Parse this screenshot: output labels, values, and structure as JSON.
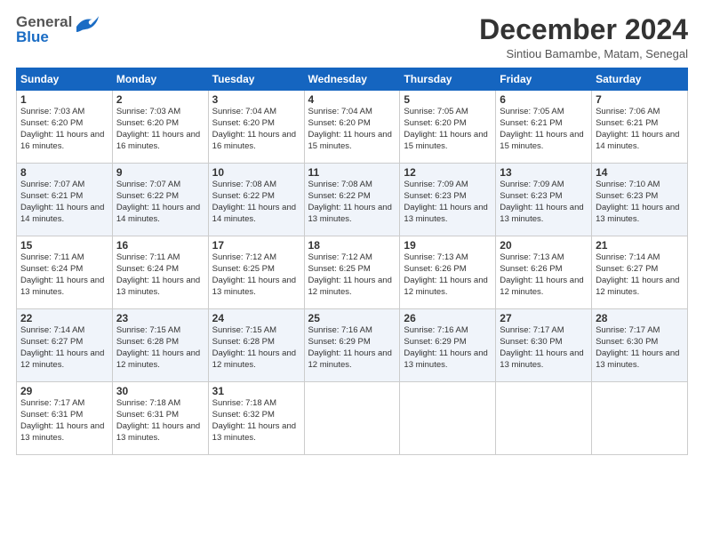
{
  "header": {
    "logo_line1": "General",
    "logo_line2": "Blue",
    "month_title": "December 2024",
    "location": "Sintiou Bamambe, Matam, Senegal"
  },
  "days_of_week": [
    "Sunday",
    "Monday",
    "Tuesday",
    "Wednesday",
    "Thursday",
    "Friday",
    "Saturday"
  ],
  "weeks": [
    [
      {
        "day": "1",
        "info": "Sunrise: 7:03 AM\nSunset: 6:20 PM\nDaylight: 11 hours and 16 minutes."
      },
      {
        "day": "2",
        "info": "Sunrise: 7:03 AM\nSunset: 6:20 PM\nDaylight: 11 hours and 16 minutes."
      },
      {
        "day": "3",
        "info": "Sunrise: 7:04 AM\nSunset: 6:20 PM\nDaylight: 11 hours and 16 minutes."
      },
      {
        "day": "4",
        "info": "Sunrise: 7:04 AM\nSunset: 6:20 PM\nDaylight: 11 hours and 15 minutes."
      },
      {
        "day": "5",
        "info": "Sunrise: 7:05 AM\nSunset: 6:20 PM\nDaylight: 11 hours and 15 minutes."
      },
      {
        "day": "6",
        "info": "Sunrise: 7:05 AM\nSunset: 6:21 PM\nDaylight: 11 hours and 15 minutes."
      },
      {
        "day": "7",
        "info": "Sunrise: 7:06 AM\nSunset: 6:21 PM\nDaylight: 11 hours and 14 minutes."
      }
    ],
    [
      {
        "day": "8",
        "info": "Sunrise: 7:07 AM\nSunset: 6:21 PM\nDaylight: 11 hours and 14 minutes."
      },
      {
        "day": "9",
        "info": "Sunrise: 7:07 AM\nSunset: 6:22 PM\nDaylight: 11 hours and 14 minutes."
      },
      {
        "day": "10",
        "info": "Sunrise: 7:08 AM\nSunset: 6:22 PM\nDaylight: 11 hours and 14 minutes."
      },
      {
        "day": "11",
        "info": "Sunrise: 7:08 AM\nSunset: 6:22 PM\nDaylight: 11 hours and 13 minutes."
      },
      {
        "day": "12",
        "info": "Sunrise: 7:09 AM\nSunset: 6:23 PM\nDaylight: 11 hours and 13 minutes."
      },
      {
        "day": "13",
        "info": "Sunrise: 7:09 AM\nSunset: 6:23 PM\nDaylight: 11 hours and 13 minutes."
      },
      {
        "day": "14",
        "info": "Sunrise: 7:10 AM\nSunset: 6:23 PM\nDaylight: 11 hours and 13 minutes."
      }
    ],
    [
      {
        "day": "15",
        "info": "Sunrise: 7:11 AM\nSunset: 6:24 PM\nDaylight: 11 hours and 13 minutes."
      },
      {
        "day": "16",
        "info": "Sunrise: 7:11 AM\nSunset: 6:24 PM\nDaylight: 11 hours and 13 minutes."
      },
      {
        "day": "17",
        "info": "Sunrise: 7:12 AM\nSunset: 6:25 PM\nDaylight: 11 hours and 13 minutes."
      },
      {
        "day": "18",
        "info": "Sunrise: 7:12 AM\nSunset: 6:25 PM\nDaylight: 11 hours and 12 minutes."
      },
      {
        "day": "19",
        "info": "Sunrise: 7:13 AM\nSunset: 6:26 PM\nDaylight: 11 hours and 12 minutes."
      },
      {
        "day": "20",
        "info": "Sunrise: 7:13 AM\nSunset: 6:26 PM\nDaylight: 11 hours and 12 minutes."
      },
      {
        "day": "21",
        "info": "Sunrise: 7:14 AM\nSunset: 6:27 PM\nDaylight: 11 hours and 12 minutes."
      }
    ],
    [
      {
        "day": "22",
        "info": "Sunrise: 7:14 AM\nSunset: 6:27 PM\nDaylight: 11 hours and 12 minutes."
      },
      {
        "day": "23",
        "info": "Sunrise: 7:15 AM\nSunset: 6:28 PM\nDaylight: 11 hours and 12 minutes."
      },
      {
        "day": "24",
        "info": "Sunrise: 7:15 AM\nSunset: 6:28 PM\nDaylight: 11 hours and 12 minutes."
      },
      {
        "day": "25",
        "info": "Sunrise: 7:16 AM\nSunset: 6:29 PM\nDaylight: 11 hours and 12 minutes."
      },
      {
        "day": "26",
        "info": "Sunrise: 7:16 AM\nSunset: 6:29 PM\nDaylight: 11 hours and 13 minutes."
      },
      {
        "day": "27",
        "info": "Sunrise: 7:17 AM\nSunset: 6:30 PM\nDaylight: 11 hours and 13 minutes."
      },
      {
        "day": "28",
        "info": "Sunrise: 7:17 AM\nSunset: 6:30 PM\nDaylight: 11 hours and 13 minutes."
      }
    ],
    [
      {
        "day": "29",
        "info": "Sunrise: 7:17 AM\nSunset: 6:31 PM\nDaylight: 11 hours and 13 minutes."
      },
      {
        "day": "30",
        "info": "Sunrise: 7:18 AM\nSunset: 6:31 PM\nDaylight: 11 hours and 13 minutes."
      },
      {
        "day": "31",
        "info": "Sunrise: 7:18 AM\nSunset: 6:32 PM\nDaylight: 11 hours and 13 minutes."
      },
      null,
      null,
      null,
      null
    ]
  ]
}
